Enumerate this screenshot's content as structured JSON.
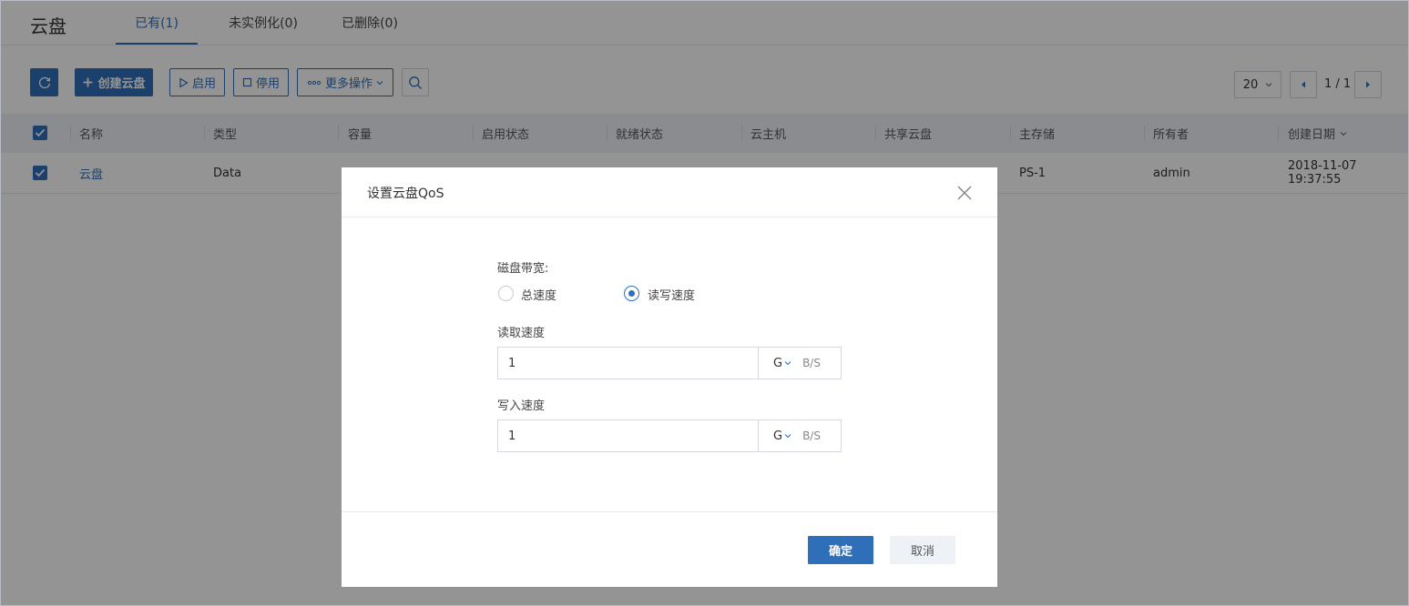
{
  "header": {
    "title": "云盘",
    "tabs": [
      {
        "label": "已有(1)",
        "active": true
      },
      {
        "label": "未实例化(0)",
        "active": false
      },
      {
        "label": "已删除(0)",
        "active": false
      }
    ]
  },
  "toolbar": {
    "refresh_icon": "refresh-icon",
    "create_label": "创建云盘",
    "enable_label": "启用",
    "disable_label": "停用",
    "more_label": "更多操作",
    "search_icon": "search-icon",
    "page_size": "20",
    "page_indicator": "1 / 1"
  },
  "table": {
    "columns": [
      "名称",
      "类型",
      "容量",
      "启用状态",
      "就绪状态",
      "云主机",
      "共享云盘",
      "主存储",
      "所有者",
      "创建日期"
    ],
    "rows": [
      {
        "name": "云盘",
        "type": "Data",
        "primary_storage": "PS-1",
        "owner": "admin",
        "created": "2018-11-07 19:37:55"
      }
    ]
  },
  "modal": {
    "title": "设置云盘QoS",
    "bandwidth_label": "磁盘带宽:",
    "radio_total": "总速度",
    "radio_rw": "读写速度",
    "selected": "读写速度",
    "read_label": "读取速度",
    "read_value": "1",
    "read_unit": "G",
    "write_label": "写入速度",
    "write_value": "1",
    "write_unit": "G",
    "unit_suffix": "B/S",
    "ok_label": "确定",
    "cancel_label": "取消"
  },
  "colors": {
    "accent": "#2f6fba",
    "overlay": "rgba(0,0,0,0.42)"
  }
}
